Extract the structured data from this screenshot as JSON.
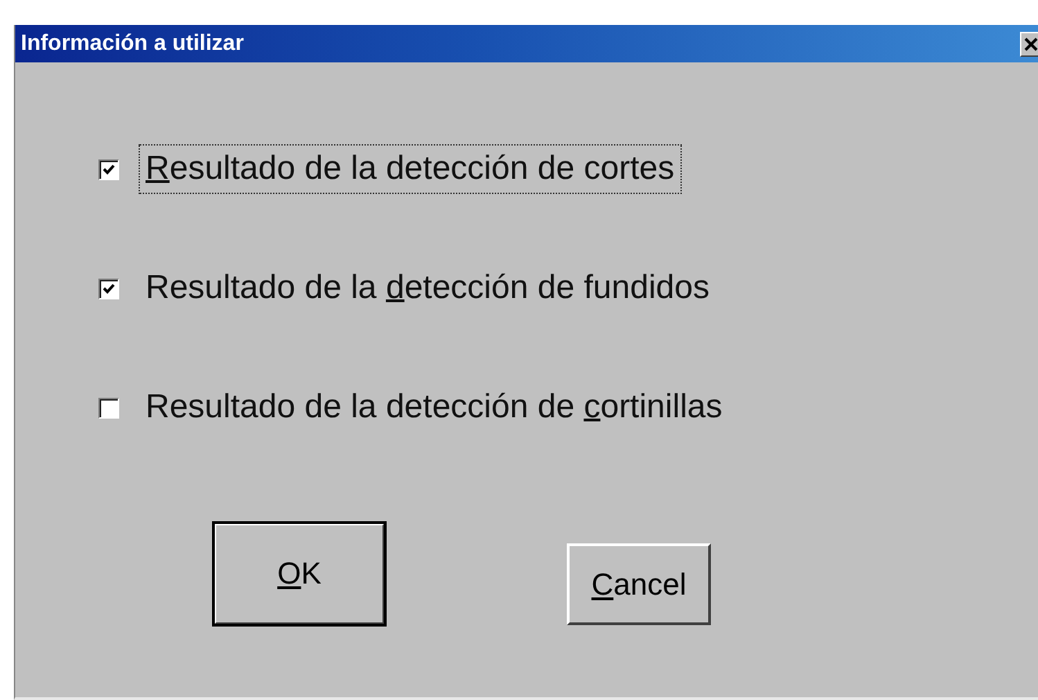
{
  "window": {
    "title": "Información a utilizar"
  },
  "options": [
    {
      "access_key": "R",
      "text_after": "esultado de la detección de cortes",
      "checked": true,
      "focused": true
    },
    {
      "text_before": "Resultado de la ",
      "access_key": "d",
      "text_after": "etección de fundidos",
      "checked": true,
      "focused": false
    },
    {
      "text_before": "Resultado de la detección de ",
      "access_key": "c",
      "text_after": "ortinillas",
      "checked": false,
      "focused": false
    }
  ],
  "buttons": [
    {
      "access_key": "O",
      "text_after": "K",
      "kind": "default"
    },
    {
      "access_key": "C",
      "text_after": "ancel",
      "kind": "normal"
    }
  ]
}
